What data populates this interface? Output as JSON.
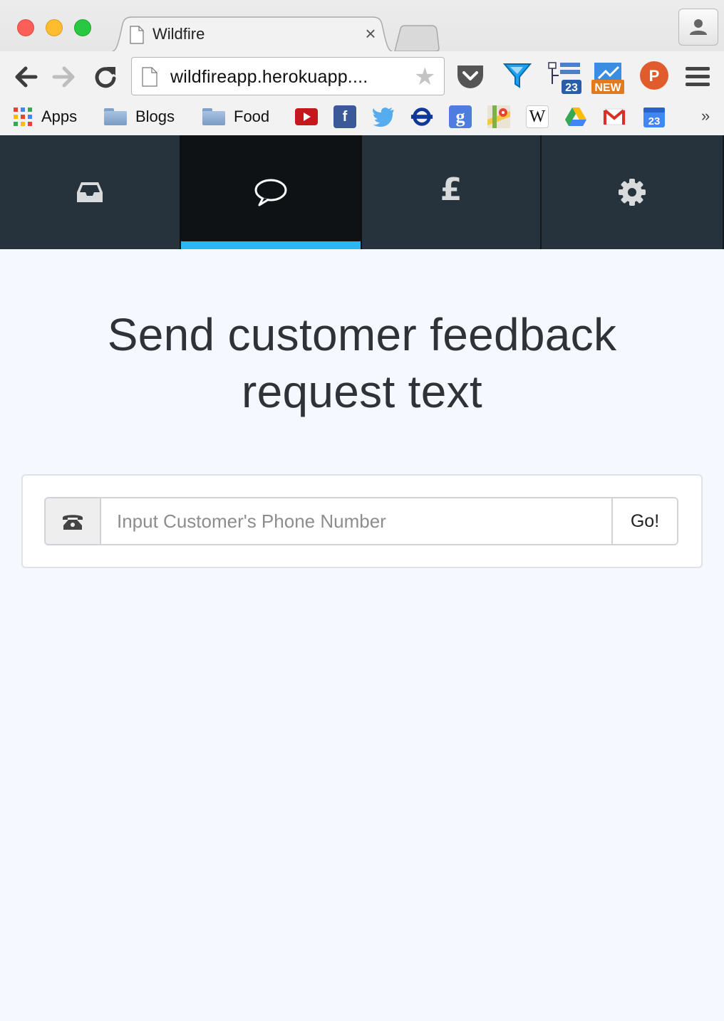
{
  "browser": {
    "tab_title": "Wildfire",
    "tab_close": "×",
    "url": "wildfireapp.herokuapp....",
    "bookmarks": [
      {
        "label": "Apps",
        "icon": "apps-grid-icon"
      },
      {
        "label": "Blogs",
        "icon": "folder-icon"
      },
      {
        "label": "Food",
        "icon": "folder-icon"
      }
    ],
    "bookmark_icons": [
      "youtube-icon",
      "facebook-icon",
      "twitter-icon",
      "tfl-roundel-icon",
      "google-icon",
      "google-maps-icon",
      "wikipedia-icon",
      "google-drive-icon",
      "gmail-icon",
      "calendar-icon"
    ],
    "extensions": [
      "pocket-icon",
      "filter-icon",
      "sitemap-23-icon",
      "new-badge-icon",
      "producthunt-icon"
    ],
    "ext_badges": {
      "sitemap": "23",
      "new": "NEW",
      "producthunt": "P",
      "calendar": "23",
      "facebook": "f",
      "google": "g",
      "wikipedia": "W"
    },
    "overflow": "»"
  },
  "nav": {
    "items": [
      {
        "name": "inbox",
        "icon": "inbox-icon",
        "active": false
      },
      {
        "name": "feedback",
        "icon": "speech-bubble-icon",
        "active": true
      },
      {
        "name": "payments",
        "icon": "pound-icon",
        "glyph": "£",
        "active": false
      },
      {
        "name": "settings",
        "icon": "gear-icon",
        "active": false
      }
    ],
    "active_color": "#29b6f6"
  },
  "main": {
    "heading_line1": "Send customer feedback",
    "heading_line2": "request text",
    "phone_placeholder": "Input Customer's Phone Number",
    "phone_value": "",
    "go_label": "Go!"
  }
}
